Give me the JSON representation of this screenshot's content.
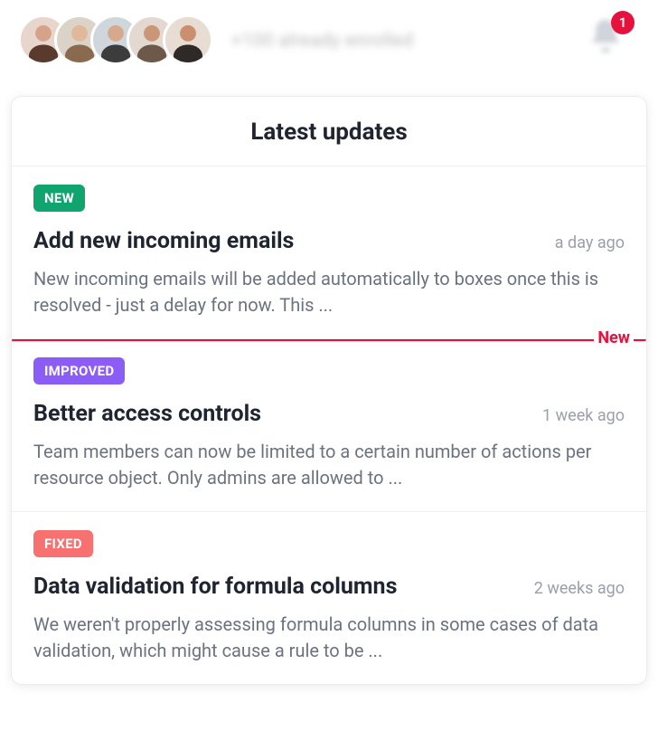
{
  "header": {
    "waitlist_text": "+100 already enrolled",
    "badge_count": "1"
  },
  "panel": {
    "title": "Latest updates",
    "new_divider_label": "New",
    "items": [
      {
        "tag": "NEW",
        "tag_class": "tag-new",
        "title": "Add new incoming emails",
        "time": "a day ago",
        "desc": "New incoming emails will be added automatically to boxes once this is resolved - just a delay for now.  This ..."
      },
      {
        "tag": "IMPROVED",
        "tag_class": "tag-improved",
        "title": "Better access controls",
        "time": "1 week ago",
        "desc": "Team members can now be limited to a certain number of actions per resource object. Only admins are allowed to ..."
      },
      {
        "tag": "FIXED",
        "tag_class": "tag-fixed",
        "title": "Data validation for formula columns",
        "time": "2 weeks ago",
        "desc": "We weren't properly assessing formula columns in some cases of data validation, which might cause a rule to be ..."
      }
    ]
  }
}
